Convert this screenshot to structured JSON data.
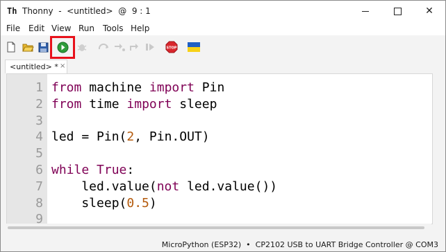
{
  "window": {
    "title": "Thonny  -  <untitled>  @  9 : 1",
    "app_icon_text": "Th"
  },
  "menu": [
    "File",
    "Edit",
    "View",
    "Run",
    "Tools",
    "Help"
  ],
  "toolbar": {
    "icons": [
      "new-file-icon",
      "open-folder-icon",
      "save-icon",
      "run-icon",
      "debug-icon",
      "step-over-icon",
      "step-into-icon",
      "step-out-icon",
      "resume-icon",
      "stop-icon",
      "ukraine-flag-icon"
    ],
    "stop_label": "STOP"
  },
  "tab": {
    "label": "<untitled> *",
    "close": "×"
  },
  "editor": {
    "line_numbers": [
      "1",
      "2",
      "3",
      "4",
      "5",
      "6",
      "7",
      "8",
      "9"
    ],
    "lines": [
      [
        {
          "t": "from",
          "c": "kw"
        },
        {
          "t": " machine ",
          "c": ""
        },
        {
          "t": "import",
          "c": "kw"
        },
        {
          "t": " Pin",
          "c": ""
        }
      ],
      [
        {
          "t": "from",
          "c": "kw"
        },
        {
          "t": " time ",
          "c": ""
        },
        {
          "t": "import",
          "c": "kw"
        },
        {
          "t": " sleep",
          "c": ""
        }
      ],
      [],
      [
        {
          "t": "led = Pin(",
          "c": ""
        },
        {
          "t": "2",
          "c": "num"
        },
        {
          "t": ", Pin.OUT)",
          "c": ""
        }
      ],
      [],
      [
        {
          "t": "while",
          "c": "kw"
        },
        {
          "t": " ",
          "c": ""
        },
        {
          "t": "True",
          "c": "kw"
        },
        {
          "t": ":",
          "c": ""
        }
      ],
      [
        {
          "t": "    led.value(",
          "c": ""
        },
        {
          "t": "not",
          "c": "kw"
        },
        {
          "t": " led.value())",
          "c": ""
        }
      ],
      [
        {
          "t": "    sleep(",
          "c": ""
        },
        {
          "t": "0.5",
          "c": "num"
        },
        {
          "t": ")",
          "c": ""
        }
      ],
      []
    ]
  },
  "status": {
    "interpreter": "MicroPython (ESP32)  •  CP2102 USB to UART Bridge Controller @ COM3"
  },
  "colors": {
    "keyword": "#7f0055",
    "number": "#b45a0c",
    "highlight": "#e8111b"
  }
}
